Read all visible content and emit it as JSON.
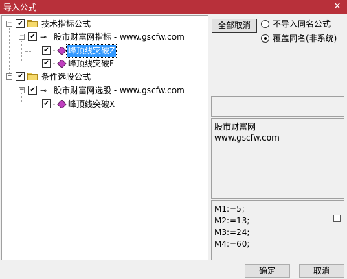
{
  "window": {
    "title": "导入公式",
    "close_glyph": "✕"
  },
  "tree": {
    "nodes": [
      {
        "label": "技术指标公式"
      },
      {
        "label": "股市财富网指标 - www.gscfw.com"
      },
      {
        "label": "峰顶线突破Z"
      },
      {
        "label": "峰顶线突破F"
      },
      {
        "label": "条件选股公式"
      },
      {
        "label": "股市财富网选股 - www.gscfw.com"
      },
      {
        "label": "峰顶线突破X"
      }
    ],
    "expander_glyph": "−",
    "check_glyph": "✔"
  },
  "controls": {
    "cancel_all_label": "全部取消",
    "option_skip_label": "不导入同名公式",
    "option_overwrite_label": "覆盖同名(非系统)",
    "selected_option": "overwrite"
  },
  "description": {
    "lines": [
      "股市财富网",
      "www.gscfw.com"
    ]
  },
  "formula": {
    "lines": [
      "M1:=5;",
      "M2:=13;",
      "M3:=24;",
      "M4:=60;"
    ]
  },
  "footer": {
    "ok_label": "确定",
    "cancel_label": "取消"
  },
  "colors": {
    "titlebar": "#b8303a",
    "selection": "#3399ff"
  }
}
